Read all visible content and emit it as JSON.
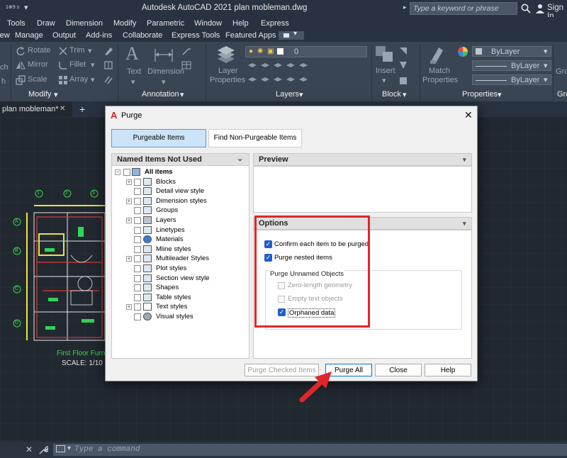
{
  "titlebar": {
    "title": "Autodesk AutoCAD 2021   plan mobleman.dwg",
    "search_placeholder": "Type a keyword or phrase",
    "signin": "Sign In",
    "qa_text": "1⊕9 ɜ"
  },
  "menubar": {
    "items": [
      "Tools",
      "Draw",
      "Dimension",
      "Modify",
      "Parametric",
      "Window",
      "Help",
      "Express"
    ]
  },
  "ribbon_tabs": {
    "items": [
      "View",
      "Manage",
      "Output",
      "Add-ins",
      "Collaborate",
      "Express Tools",
      "Featured Apps"
    ]
  },
  "ribbon": {
    "modify": {
      "rotate": "Rotate",
      "trim": "Trim",
      "mirror": "Mirror",
      "fillet": "Fillet",
      "scale": "Scale",
      "array": "Array",
      "label": "Modify"
    },
    "annotation": {
      "text": "Text",
      "dimension": "Dimension",
      "label": "Annotation"
    },
    "layers": {
      "layer_properties_1": "Layer",
      "layer_properties_2": "Properties",
      "current_layer": "0",
      "label": "Layers"
    },
    "block": {
      "insert": "Insert",
      "label": "Block"
    },
    "properties": {
      "match_1": "Match",
      "match_2": "Properties",
      "bylayer_1": "ByLayer",
      "bylayer_2": "ByLayer",
      "bylayer_3": "ByLayer",
      "label": "Properties"
    },
    "groups_label": "Gro",
    "draw_frag": [
      "ch",
      "h"
    ],
    "group_frag": "Gro"
  },
  "doctab": {
    "name": "plan mobleman*",
    "close": "✕",
    "add": "+"
  },
  "drawing": {
    "caption_title": "First Floor Furni",
    "caption_scale": "SCALE:    1/10",
    "col_labels": [
      "1",
      "2",
      "3"
    ],
    "row_labels": [
      "A",
      "B",
      "C",
      "D"
    ]
  },
  "cmdline": {
    "placeholder": "Type a command"
  },
  "dialog": {
    "title": "Purge",
    "tab_purgeable": "Purgeable Items",
    "tab_nonpurgeable": "Find Non-Purgeable Items",
    "tree_header": "Named Items Not Used",
    "tree_items": [
      "All items",
      "Blocks",
      "Detail view style",
      "Dimension styles",
      "Groups",
      "Layers",
      "Linetypes",
      "Materials",
      "Mline styles",
      "Multileader Styles",
      "Plot styles",
      "Section view style",
      "Shapes",
      "Table styles",
      "Text styles",
      "Visual styles"
    ],
    "preview_header": "Preview",
    "options_header": "Options",
    "opt_confirm": "Confirm each item to be purged",
    "opt_nested": "Purge nested items",
    "unnamed_group": "Purge Unnamed Objects",
    "opt_zero": "Zero-length geometry",
    "opt_empty": "Empty text objects",
    "opt_orphaned": "Orphaned data",
    "btn_purge_checked": "Purge Checked Items",
    "btn_purge_all": "Purge All",
    "btn_close": "Close",
    "btn_help": "Help",
    "highlight_color": "#e0262a"
  }
}
